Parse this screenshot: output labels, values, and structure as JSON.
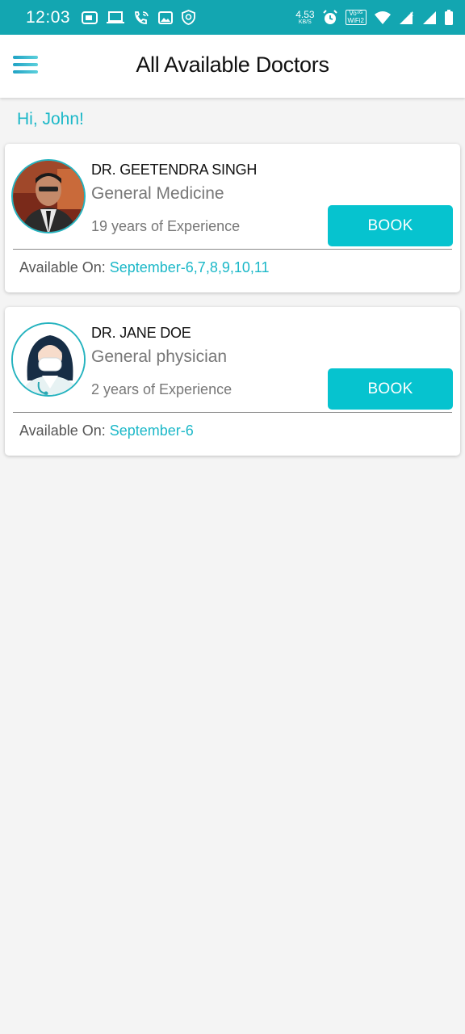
{
  "status_bar": {
    "time": "12:03",
    "speed_value": "4.53",
    "speed_unit": "KB/S",
    "volte_top": "Vo⁴ᴳ",
    "volte_bottom": "WiFi2",
    "left_icons": [
      "message-icon",
      "laptop-icon",
      "wifi-call-icon",
      "image-icon",
      "shield-icon"
    ],
    "right_icons": [
      "alarm-icon",
      "wifi-icon",
      "signal-icon",
      "signal-icon",
      "battery-icon"
    ]
  },
  "header": {
    "title": "All Available Doctors",
    "menu_icon": "hamburger-menu-icon"
  },
  "greeting": "Hi, John!",
  "doctors": [
    {
      "name": "DR. GEETENDRA SINGH",
      "specialty": "General Medicine",
      "experience": "19 years of Experience",
      "book_label": "BOOK",
      "available_label": "Available On:",
      "available_dates": "September-6,7,8,9,10,11"
    },
    {
      "name": "DR. JANE DOE",
      "specialty": "General physician",
      "experience": "2 years of Experience",
      "book_label": "BOOK",
      "available_label": "Available On:",
      "available_dates": "September-6"
    }
  ],
  "colors": {
    "status_bar": "#13a6b1",
    "accent": "#1cb8c8",
    "button": "#06c3cf"
  }
}
